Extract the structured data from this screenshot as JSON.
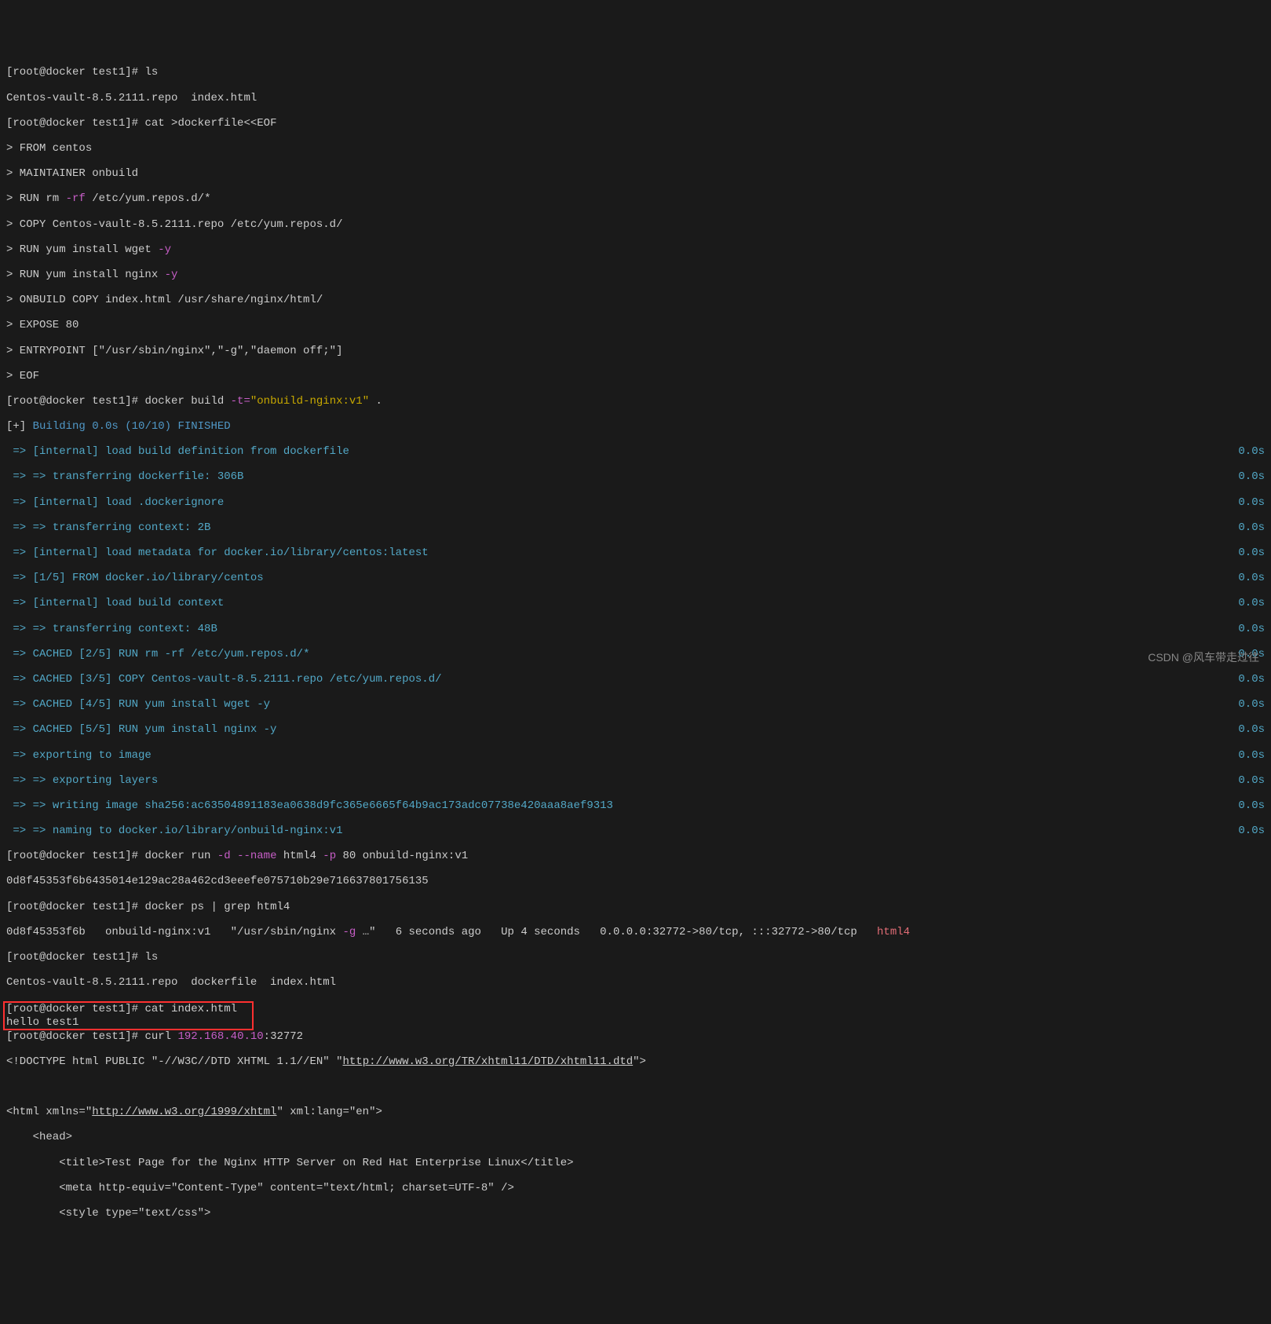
{
  "prompt1": "[root@docker test1]# ",
  "l1_cmd": "ls",
  "l2": "Centos-vault-8.5.2111.repo  index.html",
  "l3_cmd": "cat >dockerfile<<EOF",
  "l4": "> FROM centos",
  "l5": "> MAINTAINER onbuild",
  "l6a": "> RUN rm ",
  "l6b": "-rf",
  "l6c": " /etc/yum.repos.d/*",
  "l7": "> COPY Centos-vault-8.5.2111.repo /etc/yum.repos.d/",
  "l8a": "> RUN yum install wget ",
  "l8b": "-y",
  "l9a": "> RUN yum install nginx ",
  "l9b": "-y",
  "l10": "> ONBUILD COPY index.html /usr/share/nginx/html/",
  "l11": "> EXPOSE 80",
  "l12": "> ENTRYPOINT [\"/usr/sbin/nginx\",\"-g\",\"daemon off;\"]",
  "l13": "> EOF",
  "l14a": "docker build ",
  "l14b": "-t=",
  "l14c": "\"onbuild-nginx:v1\"",
  "l14d": " .",
  "l15a": "[+]",
  "l15b": " Building 0.0s (10/10) FINISHED",
  "arrow": " => ",
  "arrow2": " => => ",
  "zero": "0.0s",
  "b1": "[internal] load build definition from dockerfile",
  "b2": "transferring dockerfile: 306B",
  "b3": "[internal] load .dockerignore",
  "b4": "transferring context: 2B",
  "b5": "[internal] load metadata for docker.io/library/centos:latest",
  "b6": "[1/5] FROM docker.io/library/centos",
  "b7": "[internal] load build context",
  "b8": "transferring context: 48B",
  "b9": "CACHED [2/5] RUN rm -rf /etc/yum.repos.d/*",
  "b10": "CACHED [3/5] COPY Centos-vault-8.5.2111.repo /etc/yum.repos.d/",
  "b11": "CACHED [4/5] RUN yum install wget -y",
  "b12": "CACHED [5/5] RUN yum install nginx -y",
  "b13": "exporting to image",
  "b14": "exporting layers",
  "b15": "writing image sha256:ac63504891183ea0638d9fc365e6665f64b9ac173adc07738e420aaa8aef9313",
  "b16": "naming to docker.io/library/onbuild-nginx:v1",
  "r1a": "docker run ",
  "r1b": "-d --name",
  "r1c": " html4 ",
  "r1d": "-p",
  "r1e": " 80 onbuild-nginx:v1",
  "r2": "0d8f45353f6b6435014e129ac28a462cd3eeefe075710b29e716637801756135",
  "r3": "docker ps | grep html4",
  "r4a": "0d8f45353f6b   onbuild-nginx:v1   \"/usr/sbin/nginx ",
  "r4b": "-g",
  "r4c": " …\"   6 seconds ago   Up 4 seconds   0.0.0.0:32772->80/tcp, :::32772->80/tcp   ",
  "r4d": "html4",
  "r5": "ls",
  "r6": "Centos-vault-8.5.2111.repo  dockerfile  index.html",
  "r7_prompt": "[root@docker test1]# ",
  "r7_cmd": "cat index.html  ",
  "r8": "hello test1            ",
  "r9a": "curl ",
  "r9b": "192.168.40.10",
  "r9c": ":32772",
  "r10a": "<!DOCTYPE html PUBLIC \"-//W3C//DTD XHTML 1.1//EN\" \"",
  "r10b": "http://www.w3.org/TR/xhtml11/DTD/xhtml11.dtd",
  "r10c": "\">",
  "r11": "",
  "r12a": "<html xmlns=\"",
  "r12b": "http://www.w3.org/1999/xhtml",
  "r12c": "\" xml:lang=\"en\">",
  "r13": "    <head>",
  "r14": "        <title>Test Page for the Nginx HTTP Server on Red Hat Enterprise Linux</title>",
  "r15": "        <meta http-equiv=\"Content-Type\" content=\"text/html; charset=UTF-8\" />",
  "r16": "        <style type=\"text/css\">",
  "watermark": "CSDN @风车带走过往"
}
